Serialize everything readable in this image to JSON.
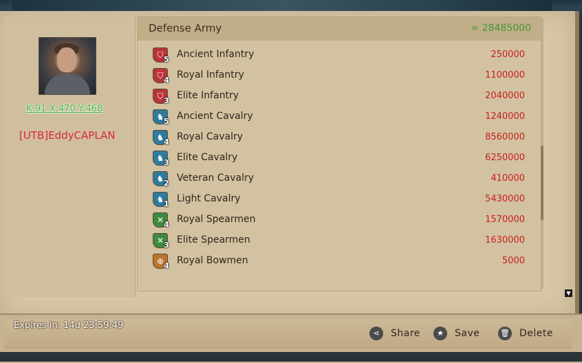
{
  "player": {
    "coords": "K:91 X:470 Y:468",
    "name": "[UTB]EddyCAPLAN"
  },
  "army": {
    "title": "Defense Army",
    "total": "≈ 28485000",
    "units": [
      {
        "name": "Ancient Infantry",
        "tier": "5",
        "count": "250000",
        "type": "infantry-icon"
      },
      {
        "name": "Royal Infantry",
        "tier": "4",
        "count": "1100000",
        "type": "infantry-icon"
      },
      {
        "name": "Elite Infantry",
        "tier": "3",
        "count": "2040000",
        "type": "infantry-icon"
      },
      {
        "name": "Ancient Cavalry",
        "tier": "5",
        "count": "1240000",
        "type": "cavalry-icon"
      },
      {
        "name": "Royal Cavalry",
        "tier": "4",
        "count": "8560000",
        "type": "cavalry-icon"
      },
      {
        "name": "Elite Cavalry",
        "tier": "3",
        "count": "6250000",
        "type": "cavalry-icon"
      },
      {
        "name": "Veteran Cavalry",
        "tier": "2",
        "count": "410000",
        "type": "cavalry-icon"
      },
      {
        "name": "Light Cavalry",
        "tier": "1",
        "count": "5430000",
        "type": "cavalry-icon"
      },
      {
        "name": "Royal Spearmen",
        "tier": "4",
        "count": "1570000",
        "type": "spearmen-icon"
      },
      {
        "name": "Elite Spearmen",
        "tier": "3",
        "count": "1630000",
        "type": "spearmen-icon"
      },
      {
        "name": "Royal Bowmen",
        "tier": "4",
        "count": "5000",
        "type": "bowmen-icon"
      }
    ]
  },
  "footer": {
    "expires": "Expires in: 14d 23:59:49",
    "share_label": "Share",
    "save_label": "Save",
    "delete_label": "Delete"
  },
  "colors": {
    "count": "#c81e1e",
    "total": "#3f9a3a",
    "coords": "#3dbb3d",
    "player_name": "#d8283a"
  }
}
